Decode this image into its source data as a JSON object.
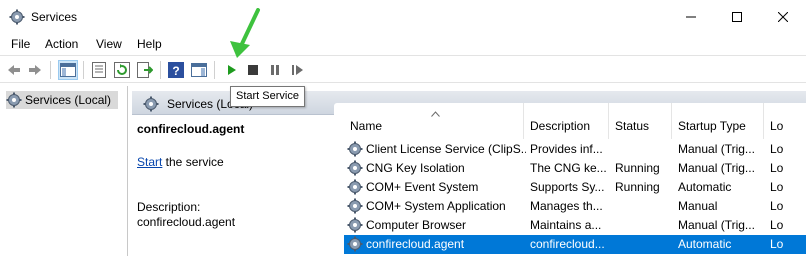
{
  "window": {
    "title": "Services",
    "app_icon": "gear-icon",
    "controls": [
      "minimize-icon",
      "maximize-icon",
      "close-icon"
    ]
  },
  "menu": [
    "File",
    "Action",
    "View",
    "Help"
  ],
  "toolbar": {
    "buttons": [
      "back-arrow-icon",
      "forward-arrow-icon",
      "console-tree-icon",
      "properties-icon",
      "refresh-icon",
      "export-list-icon",
      "help-icon",
      "action-pane-icon",
      "play-icon",
      "stop-icon",
      "pause-icon",
      "restart-icon"
    ],
    "tooltip": "Start Service",
    "accent_color": "#0078d7"
  },
  "left_pane": {
    "item": "Services (Local)"
  },
  "main_header": {
    "title": "Services (Local)"
  },
  "description": {
    "service_name": "confirecloud.agent",
    "start_link": "Start",
    "start_suffix": " the service",
    "label": "Description:",
    "text": "confirecloud.agent"
  },
  "table": {
    "columns": [
      "Name",
      "Description",
      "Status",
      "Startup Type",
      "Lo"
    ],
    "rows": [
      {
        "name": "Client License Service (ClipS...",
        "description": "Provides inf...",
        "status": "",
        "startup": "Manual (Trig...",
        "logon": "Lo"
      },
      {
        "name": "CNG Key Isolation",
        "description": "The CNG ke...",
        "status": "Running",
        "startup": "Manual (Trig...",
        "logon": "Lo"
      },
      {
        "name": "COM+ Event System",
        "description": "Supports Sy...",
        "status": "Running",
        "startup": "Automatic",
        "logon": "Lo"
      },
      {
        "name": "COM+ System Application",
        "description": "Manages th...",
        "status": "",
        "startup": "Manual",
        "logon": "Lo"
      },
      {
        "name": "Computer Browser",
        "description": "Maintains a...",
        "status": "",
        "startup": "Manual (Trig...",
        "logon": "Lo"
      },
      {
        "name": "confirecloud.agent",
        "description": "confirecloud...",
        "status": "",
        "startup": "Automatic",
        "logon": "Lo"
      }
    ],
    "selected_row": "confirecloud.agent"
  }
}
